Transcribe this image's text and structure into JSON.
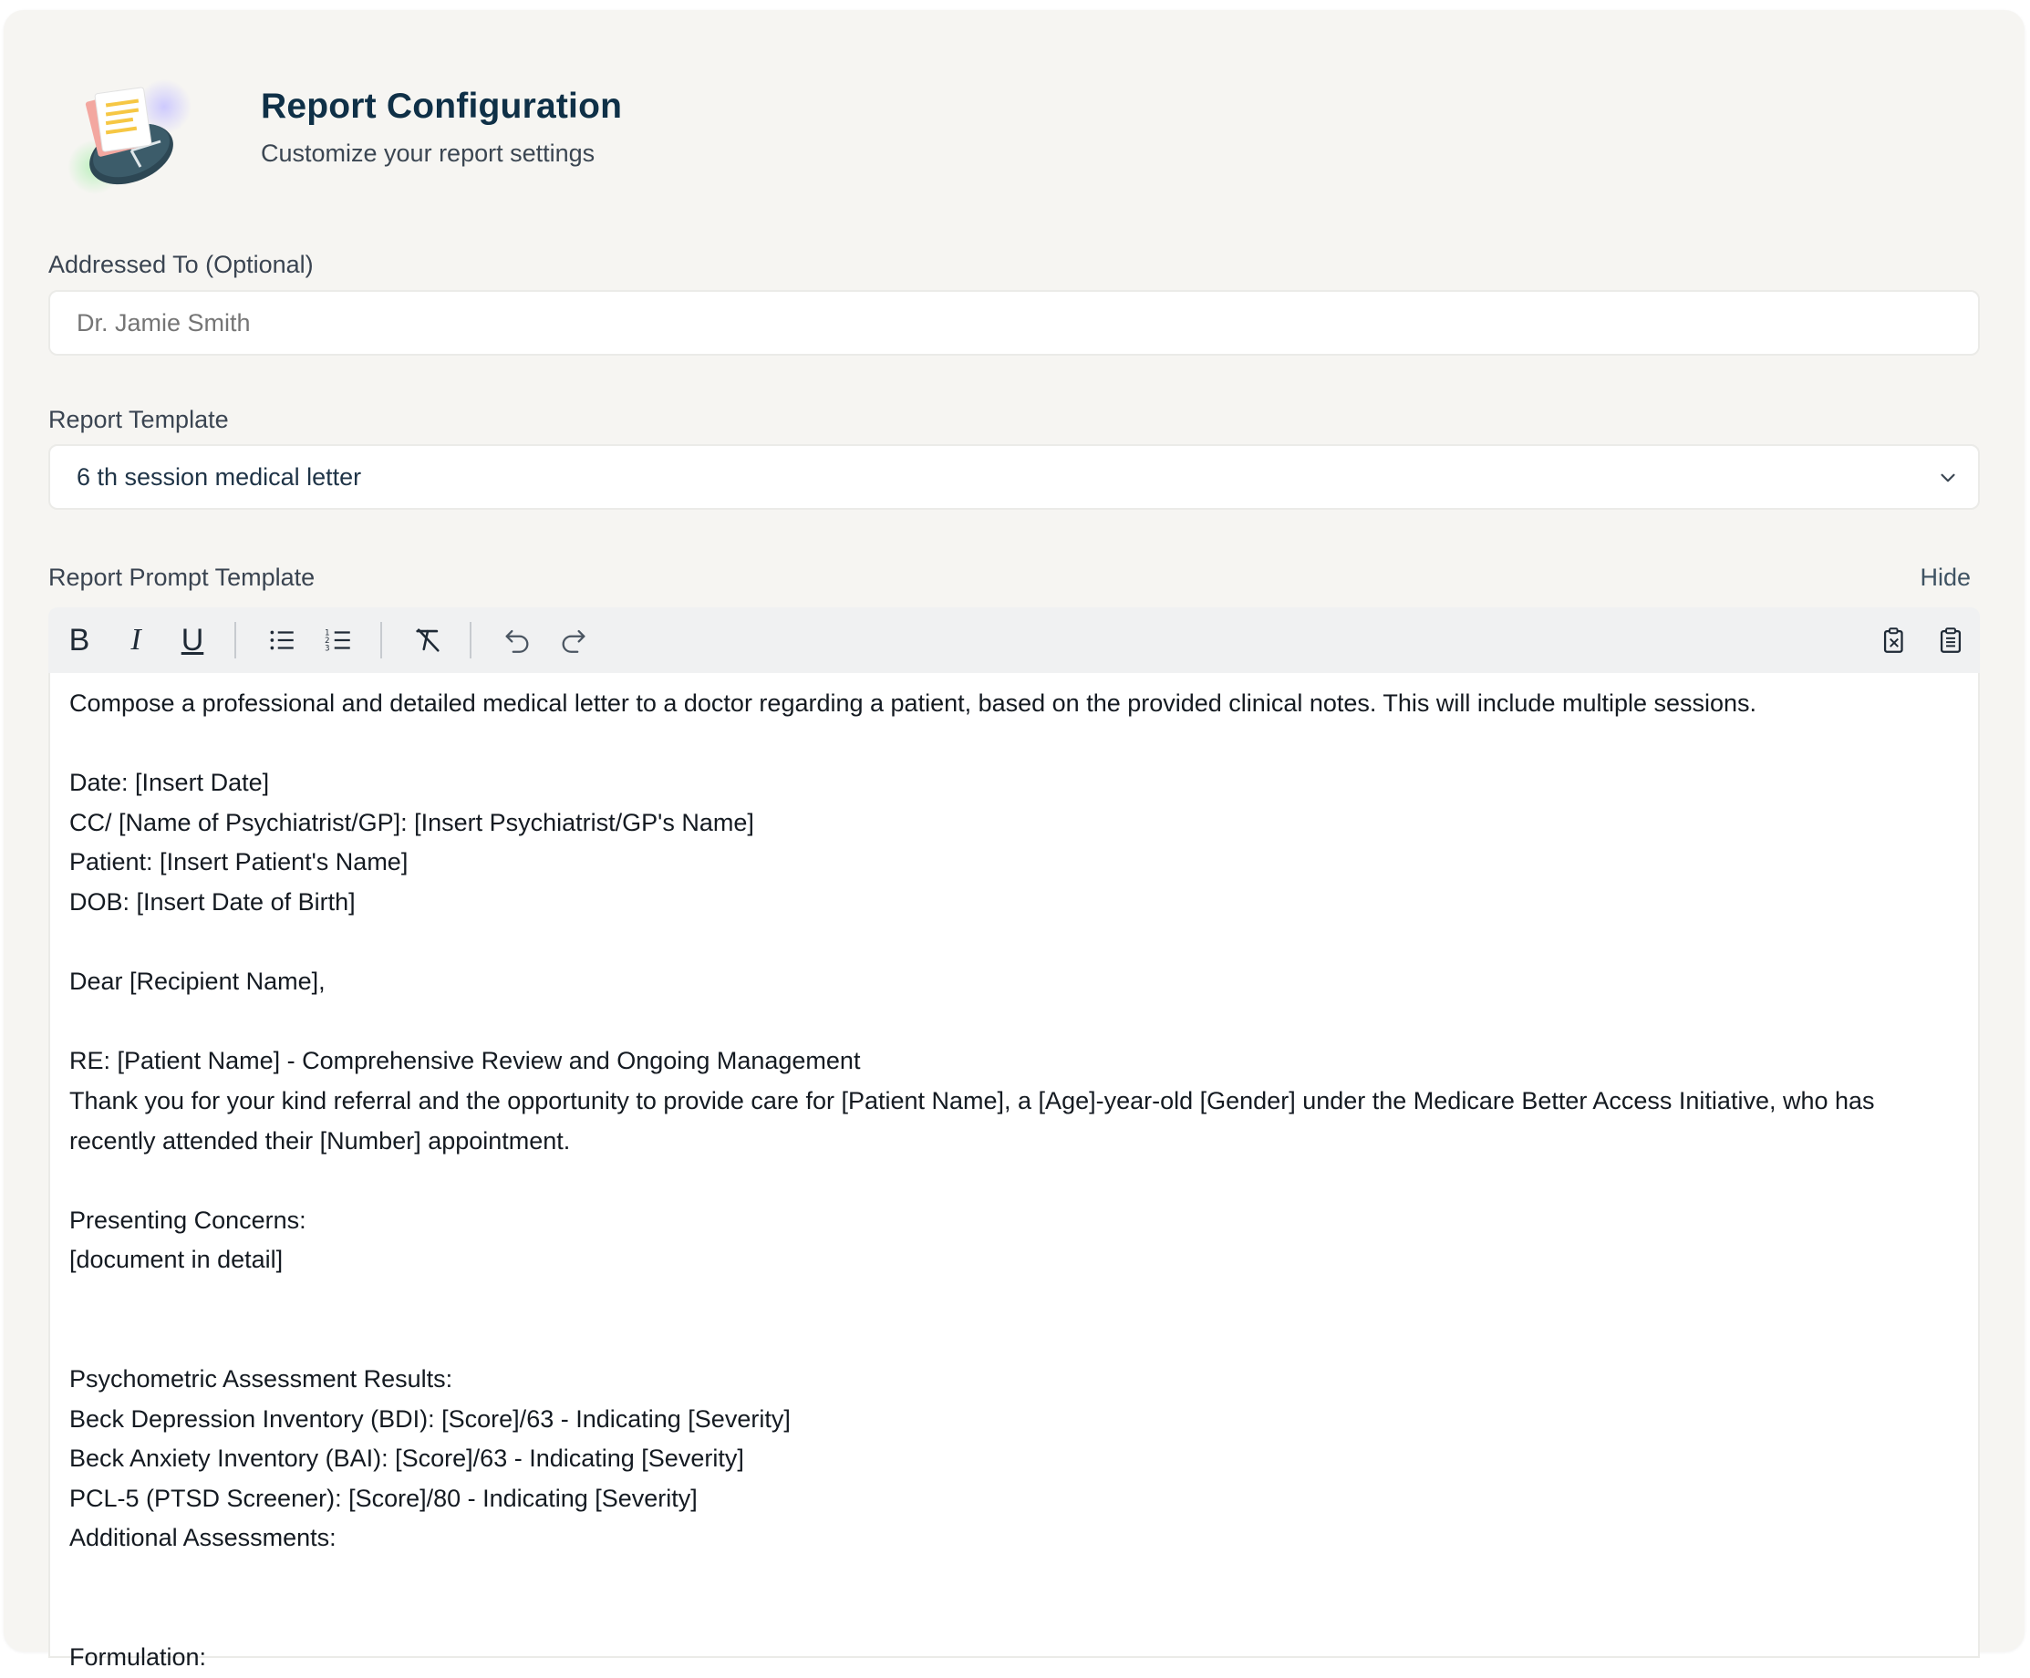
{
  "header": {
    "title": "Report Configuration",
    "subtitle": "Customize your report settings",
    "logo_icon": "report-clock-illustration"
  },
  "addressed_to": {
    "label": "Addressed To (Optional)",
    "placeholder": "Dr. Jamie Smith",
    "value": ""
  },
  "report_template": {
    "label": "Report Template",
    "selected": "6 th session medical letter",
    "icon": "chevron-down-icon"
  },
  "prompt_template": {
    "label": "Report Prompt Template",
    "hide_label": "Hide",
    "toolbar": {
      "bold": "B",
      "italic": "I",
      "underline": "U",
      "icons": [
        "bullet-list-icon",
        "numbered-list-icon",
        "clear-format-icon",
        "undo-icon",
        "redo-icon",
        "copy-icon",
        "paste-icon"
      ]
    },
    "lines": [
      "Compose a professional and detailed medical letter to a doctor regarding a patient, based on the provided clinical notes. This will include multiple sessions.",
      "",
      "Date: [Insert Date]",
      "CC/ [Name of Psychiatrist/GP]: [Insert Psychiatrist/GP's Name]",
      "Patient: [Insert Patient's Name]",
      "DOB: [Insert Date of Birth]",
      "",
      "Dear [Recipient Name],",
      "",
      "RE: [Patient Name] - Comprehensive Review and Ongoing Management",
      "Thank you for your kind referral and the opportunity to provide care for [Patient Name], a [Age]-year-old [Gender] under the Medicare Better Access Initiative, who has recently attended their [Number] appointment.",
      "",
      "Presenting Concerns:",
      "[document in detail]",
      "",
      "",
      "Psychometric Assessment Results:",
      "Beck Depression Inventory (BDI): [Score]/63 - Indicating [Severity]",
      "Beck Anxiety Inventory (BAI): [Score]/63 - Indicating [Severity]",
      "PCL-5 (PTSD Screener): [Score]/80 - Indicating [Severity]",
      "Additional Assessments:",
      "",
      "",
      "Formulation:"
    ]
  }
}
